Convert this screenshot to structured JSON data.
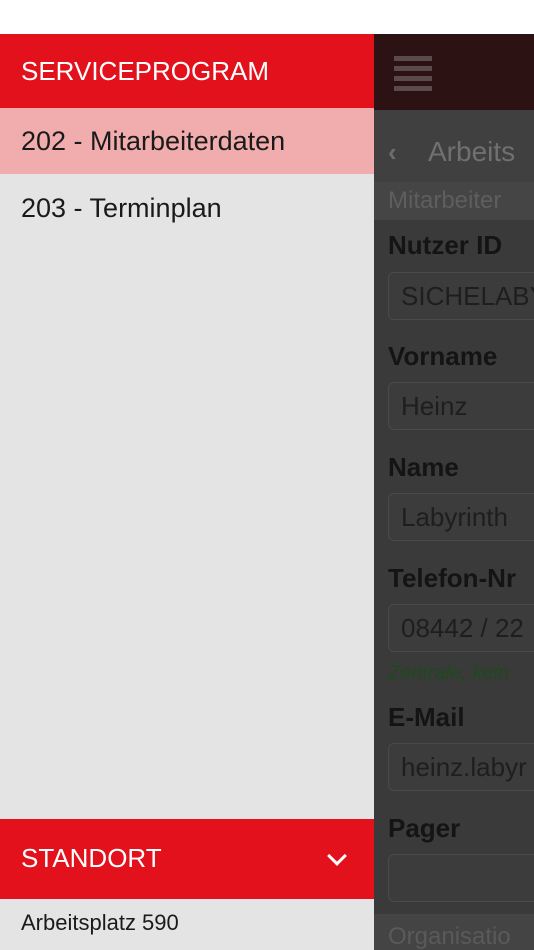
{
  "drawer": {
    "header": "SERVICEPROGRAM",
    "items": [
      {
        "label": "202 - Mitarbeiterdaten",
        "active": true
      },
      {
        "label": "203 - Terminplan",
        "active": false
      }
    ],
    "standort": {
      "label": "STANDORT",
      "icon": "chevron-down-icon"
    },
    "location_value": "Arbeitsplatz 590"
  },
  "background": {
    "title": "Arbeits",
    "section": "Mitarbeiter",
    "fields": [
      {
        "label": "Nutzer ID",
        "value": "SICHELABY"
      },
      {
        "label": "Vorname",
        "value": "Heinz"
      },
      {
        "label": "Name",
        "value": "Labyrinth"
      },
      {
        "label": "Telefon-Nr",
        "value": "08442 / 22",
        "hint": "Zentrale, kein"
      },
      {
        "label": "E-Mail",
        "value": "heinz.labyr"
      },
      {
        "label": "Pager",
        "value": ""
      }
    ],
    "footer": "Organisatio"
  },
  "colors": {
    "accent": "#e2111c",
    "active_item": "#f1adad",
    "drawer_bg": "#e4e4e4"
  }
}
